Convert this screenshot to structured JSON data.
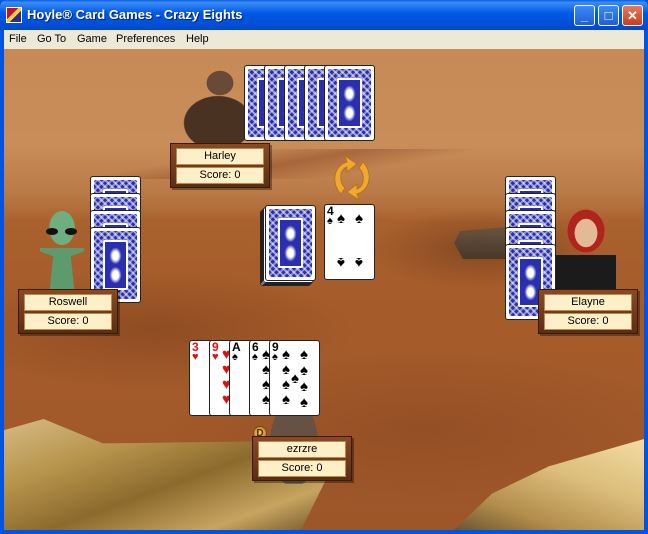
{
  "window": {
    "title": "Hoyle® Card Games - Crazy Eights",
    "controls": {
      "minimize": "_",
      "maximize": "□",
      "close": "✕"
    }
  },
  "menubar": {
    "items": [
      {
        "label": "File",
        "accel": "F"
      },
      {
        "label": "Go To",
        "accel": "T"
      },
      {
        "label": "Game",
        "accel": "G"
      },
      {
        "label": "Preferences",
        "accel": "P"
      },
      {
        "label": "Help",
        "accel": "H"
      }
    ]
  },
  "game": {
    "players": [
      {
        "name": "Harley",
        "score_label": "Score: 0",
        "position": "top",
        "avatar": "bear",
        "card_count": 5
      },
      {
        "name": "Roswell",
        "score_label": "Score: 0",
        "position": "left",
        "avatar": "alien",
        "card_count": 4
      },
      {
        "name": "Elayne",
        "score_label": "Score: 0",
        "position": "right",
        "avatar": "woman",
        "card_count": 5
      },
      {
        "name": "ezrzre",
        "score_label": "Score: 0",
        "position": "bottom",
        "avatar": "silhouette",
        "card_count": 5,
        "dealer_badge": "D"
      }
    ],
    "discard_top": {
      "rank": "4",
      "suit": "♠",
      "color": "black"
    },
    "player_hand": [
      {
        "rank": "3",
        "suit": "♥",
        "color": "red"
      },
      {
        "rank": "9",
        "suit": "♥",
        "color": "red"
      },
      {
        "rank": "A",
        "suit": "♠",
        "color": "black"
      },
      {
        "rank": "6",
        "suit": "♠",
        "color": "black"
      },
      {
        "rank": "9",
        "suit": "♠",
        "color": "black"
      }
    ],
    "direction_icon": "clockwise-arrows-icon"
  },
  "colors": {
    "titlebar": "#0058e6",
    "menubar": "#ece9d8",
    "card_back": "#2a2fb0",
    "plate_bg": "#fdf0c8",
    "plate_frame": "#6b3616",
    "arrow": "#f0a830"
  }
}
